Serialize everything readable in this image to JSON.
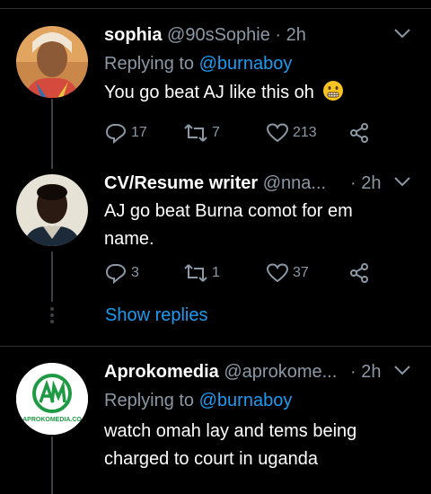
{
  "tweets": [
    {
      "name": "sophia",
      "handle": "@90sSophie",
      "sep": "·",
      "time": "2h",
      "replying_prefix": "Replying to",
      "replying_to": "@burnaboy",
      "text": "You go beat AJ like this oh",
      "emoji": "grimacing-face",
      "replies": "17",
      "retweets": "7",
      "likes": "213"
    },
    {
      "name": "CV/Resume writer",
      "handle": "@nna...",
      "sep": "·",
      "time": "2h",
      "text_line1": "AJ go beat Burna comot for em",
      "text_line2": "name.",
      "replies": "3",
      "retweets": "1",
      "likes": "37"
    },
    {
      "name": "Aprokomedia",
      "handle": "@aprokome...",
      "sep": "·",
      "time": "2h",
      "replying_prefix": "Replying to",
      "replying_to": "@burnaboy",
      "text_line1": "watch omah lay and tems being",
      "text_line2": "charged to court in uganda",
      "avatar_text": "APROKOMEDIA.CO"
    }
  ],
  "show_replies": "Show replies",
  "colors": {
    "background": "#000000",
    "link": "#1d9bf0",
    "secondary": "#8b98a5",
    "avatar_brand_green": "#1f9a44"
  }
}
